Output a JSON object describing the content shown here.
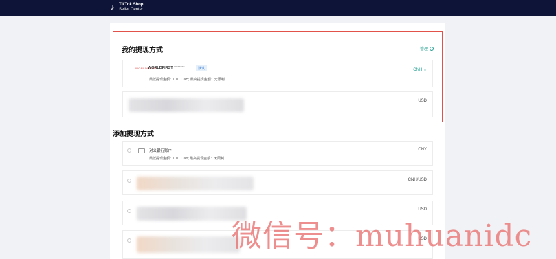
{
  "header": {
    "brand_line1": "TikTok Shop",
    "brand_line2": "Seller Center"
  },
  "my_methods": {
    "title": "我的提现方式",
    "manage_label": "管理",
    "worldfirst": {
      "logo_text": "WORLDFIRST",
      "name": "WORLDFIRST",
      "masked_account": "********",
      "badge": "默认",
      "currency": "CNH",
      "limits": "最低提现金额：0.01 CNH; 最高提现金额：无限制"
    },
    "second_method": {
      "currency": "USD"
    }
  },
  "add_methods": {
    "title": "添加提现方式",
    "items": [
      {
        "name": "对公银行账户",
        "limits": "最低提现金额：0.01 CNY; 最高提现金额：无限制",
        "currency": "CNY"
      },
      {
        "currency": "CNH/USD"
      },
      {
        "currency": "USD"
      },
      {
        "currency": "USD"
      }
    ]
  },
  "watermark": "微信号：muhuanidc"
}
